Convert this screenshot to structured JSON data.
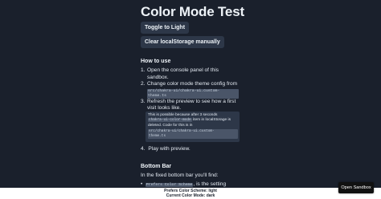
{
  "page": {
    "title": "Color Mode Test"
  },
  "buttons": {
    "toggle": "Toggle to Light",
    "clear": "Clear localStorage manually"
  },
  "how_to_use": {
    "heading": "How to use",
    "steps": [
      {
        "num": "1.",
        "text": "Open the console panel of this sandbox."
      },
      {
        "num": "2.",
        "text": "Change color mode theme config from",
        "code_lines": [
          "src/chakra-ui/chakra-ui.custom-",
          "theme.ts"
        ]
      },
      {
        "num": "3.",
        "text": "Refresh the preview to see how a first visit looks like."
      },
      {
        "num": "4.",
        "text": "Play with preview."
      }
    ],
    "note": {
      "line1": "This is possible because after 3 seconds",
      "code1": "chakra-ui-color-mode",
      "line2_tail": "item in localStorage is",
      "line3": "deleted. Code for this is in",
      "code_lines": [
        "src/chakra-ui/chakra-ui.custom-",
        "theme.ts"
      ]
    }
  },
  "bottom_section": {
    "heading": "Bottom Bar",
    "intro": "In the fixed bottom bar you'll find:",
    "item1_code": "Prefers Color Scheme",
    "item1_text": ", is the setting"
  },
  "bottom_bar": {
    "line1": "Prefers Color Scheme: light",
    "line2": "Current Color Mode: dark"
  },
  "sandbox": {
    "label": "Open Sandbox"
  },
  "colors": {
    "background": "#1a202c",
    "button_bg": "#2d3748",
    "code_bg": "#4a5568",
    "bottom_bar_bg": "#ffffff",
    "sandbox_button_bg": "#111111"
  }
}
